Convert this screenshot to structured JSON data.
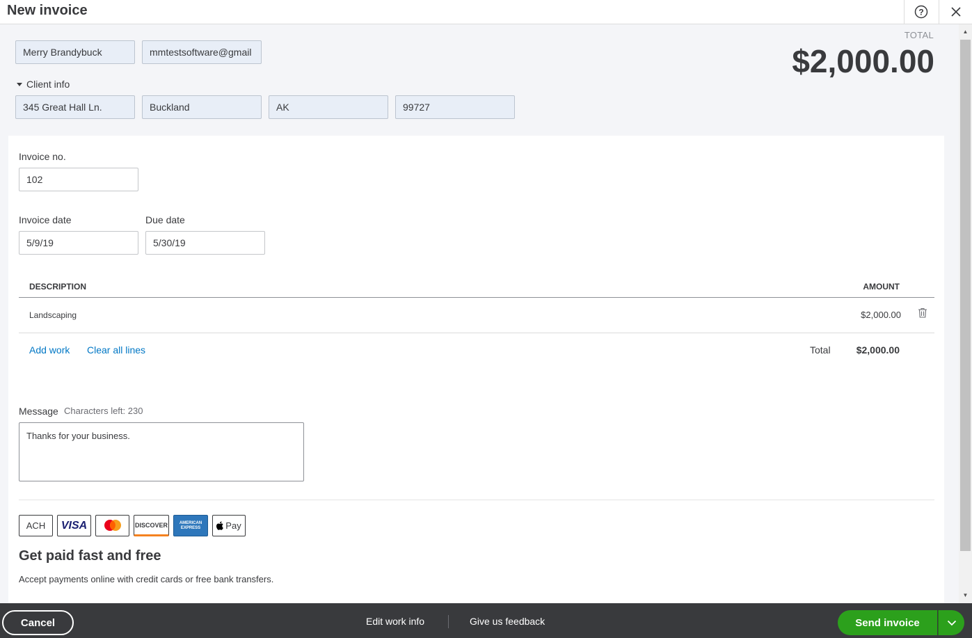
{
  "header": {
    "title": "New invoice",
    "help_icon": "help-circle-icon",
    "close_icon": "close-icon"
  },
  "customer": {
    "name": "Merry Brandybuck",
    "email": "mmtestsoftware@gmail",
    "client_info_label": "Client info",
    "address": "345 Great Hall Ln.",
    "city": "Buckland",
    "state": "AK",
    "zip": "99727"
  },
  "summary": {
    "total_label": "TOTAL",
    "total_amount": "$2,000.00"
  },
  "invoice": {
    "number_label": "Invoice no.",
    "number": "102",
    "date_label": "Invoice date",
    "date": "5/9/19",
    "due_label": "Due date",
    "due": "5/30/19"
  },
  "table": {
    "headers": {
      "description": "DESCRIPTION",
      "amount": "AMOUNT"
    },
    "rows": [
      {
        "description": "Landscaping",
        "amount": "$2,000.00"
      }
    ],
    "add_work": "Add work",
    "clear_lines": "Clear all lines",
    "total_label": "Total",
    "total_value": "$2,000.00"
  },
  "message": {
    "label": "Message",
    "chars_left": "Characters left: 230",
    "text": "Thanks for your business."
  },
  "payments": {
    "logos": {
      "ach": "ACH",
      "visa": "VISA",
      "discover": "DISCOVER",
      "amex": "AMERICAN EXPRESS",
      "applepay": "Pay"
    },
    "heading": "Get paid fast and free",
    "subtext": "Accept payments online with credit cards or free bank transfers."
  },
  "footer": {
    "cancel": "Cancel",
    "edit_work_info": "Edit work info",
    "feedback": "Give us feedback",
    "send": "Send invoice"
  },
  "colors": {
    "accent_green": "#2ca01c",
    "link_blue": "#0077c5",
    "footer_bg": "#393a3d"
  }
}
